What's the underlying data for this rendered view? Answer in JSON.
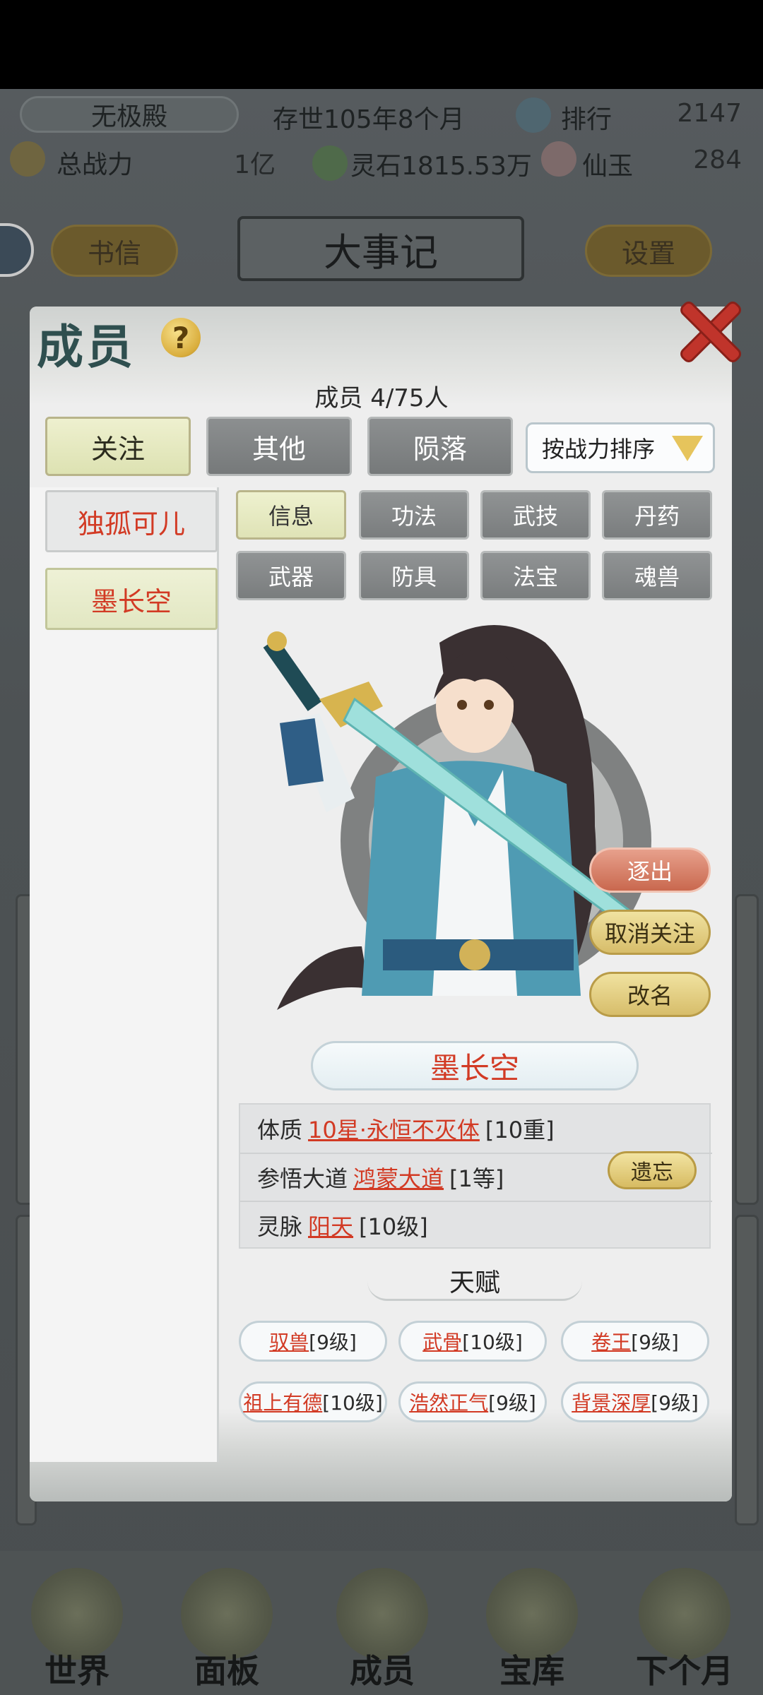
{
  "hud": {
    "sect_name": "无极殿",
    "era": "存世105年8个月",
    "rank_label": "排行",
    "rank_value": "2147",
    "power_label": "总战力",
    "power_value": "1亿",
    "spirit_stone": "灵石1815.53万",
    "jade_label": "仙玉",
    "jade_value": "284"
  },
  "bg_header": {
    "letters_button": "书信",
    "title": "大事记",
    "settings_button": "设置"
  },
  "bottom_nav": {
    "items": [
      {
        "label": "世界"
      },
      {
        "label": "面板"
      },
      {
        "label": "成员"
      },
      {
        "label": "宝库"
      },
      {
        "label": "下个月"
      }
    ]
  },
  "modal": {
    "title": "成员",
    "help": "?",
    "member_count": "成员  4/75人",
    "tabs": [
      {
        "label": "关注",
        "active": true
      },
      {
        "label": "其他",
        "active": false
      },
      {
        "label": "陨落",
        "active": false
      }
    ],
    "sort": {
      "label": "按战力排序"
    },
    "members": [
      {
        "name": "独孤可儿",
        "selected": false
      },
      {
        "name": "墨长空",
        "selected": true
      }
    ],
    "categories": [
      {
        "label": "信息",
        "active": true
      },
      {
        "label": "功法",
        "active": false
      },
      {
        "label": "武技",
        "active": false
      },
      {
        "label": "丹药",
        "active": false
      },
      {
        "label": "武器",
        "active": false
      },
      {
        "label": "防具",
        "active": false
      },
      {
        "label": "法宝",
        "active": false
      },
      {
        "label": "魂兽",
        "active": false
      }
    ],
    "actions": {
      "expel": "逐出",
      "unfollow": "取消关注",
      "rename": "改名"
    },
    "character_name": "墨长空",
    "attributes": [
      {
        "label": "体质",
        "value": "10星·永恒不灭体",
        "level": "[10重]"
      },
      {
        "label": "参悟大道",
        "value": "鸿蒙大道",
        "level": "[1等]"
      },
      {
        "label": "灵脉",
        "value": "阳天",
        "level": "[10级]"
      }
    ],
    "forget_button": "遗忘",
    "talent_title": "天赋",
    "talents": [
      {
        "name": "驭兽",
        "level": "[9级]"
      },
      {
        "name": "武骨",
        "level": "[10级]"
      },
      {
        "name": "卷王",
        "level": "[9级]"
      },
      {
        "name": "祖上有德",
        "level": "[10级]"
      },
      {
        "name": "浩然正气",
        "level": "[9级]"
      },
      {
        "name": "背景深厚",
        "level": "[9级]"
      }
    ]
  },
  "colors": {
    "accent_red": "#d23a24",
    "active_tab": "#e3e7bd",
    "inactive_tab": "#7f8283",
    "gold_button": "#d7bd6a"
  }
}
